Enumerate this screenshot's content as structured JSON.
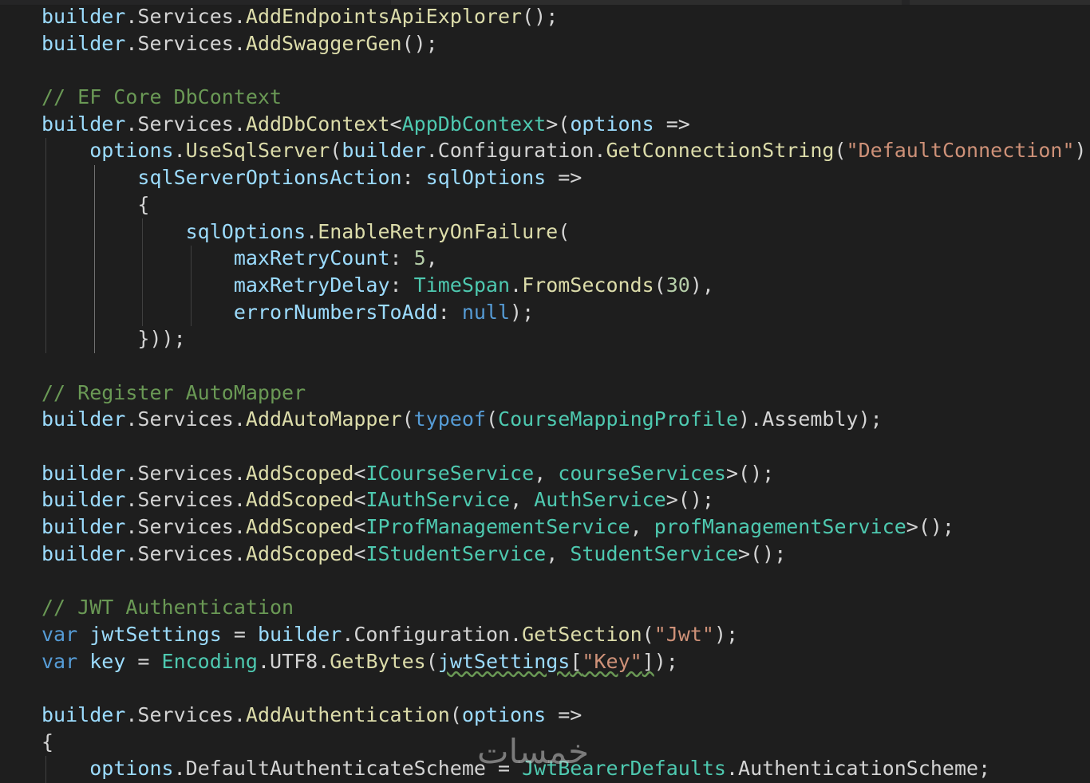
{
  "editor": {
    "language": "csharp",
    "watermark": "خمسات",
    "colors": {
      "background": "#1e1e1e",
      "variable": "#9cdcfe",
      "function": "#dcdcaa",
      "type": "#4ec9b0",
      "string": "#ce9178",
      "number": "#b5cea8",
      "keyword": "#569cd6",
      "comment": "#6a9955",
      "text": "#d4d4d4"
    },
    "lines": [
      [
        [
          "builder",
          "var"
        ],
        [
          ".",
          "punc"
        ],
        [
          "Services",
          "prop"
        ],
        [
          ".",
          "punc"
        ],
        [
          "AddEndpointsApiExplorer",
          "fn"
        ],
        [
          "();",
          "punc"
        ]
      ],
      [
        [
          "builder",
          "var"
        ],
        [
          ".",
          "punc"
        ],
        [
          "Services",
          "prop"
        ],
        [
          ".",
          "punc"
        ],
        [
          "AddSwaggerGen",
          "fn"
        ],
        [
          "();",
          "punc"
        ]
      ],
      [],
      [
        [
          "// EF Core DbContext",
          "cmt"
        ]
      ],
      [
        [
          "builder",
          "var"
        ],
        [
          ".",
          "punc"
        ],
        [
          "Services",
          "prop"
        ],
        [
          ".",
          "punc"
        ],
        [
          "AddDbContext",
          "fn"
        ],
        [
          "<",
          "punc"
        ],
        [
          "AppDbContext",
          "type"
        ],
        [
          ">(",
          "punc"
        ],
        [
          "options",
          "var"
        ],
        [
          " =>",
          "punc"
        ]
      ],
      [
        [
          "    ",
          "punc"
        ],
        [
          "options",
          "var"
        ],
        [
          ".",
          "punc"
        ],
        [
          "UseSqlServer",
          "fn"
        ],
        [
          "(",
          "punc"
        ],
        [
          "builder",
          "var"
        ],
        [
          ".",
          "punc"
        ],
        [
          "Configuration",
          "prop"
        ],
        [
          ".",
          "punc"
        ],
        [
          "GetConnectionString",
          "fn"
        ],
        [
          "(",
          "punc"
        ],
        [
          "\"DefaultConnection\"",
          "str"
        ],
        [
          ")",
          "punc"
        ]
      ],
      [
        [
          "        ",
          "punc"
        ],
        [
          "sqlServerOptionsAction",
          "var"
        ],
        [
          ": ",
          "punc"
        ],
        [
          "sqlOptions",
          "var"
        ],
        [
          " =>",
          "punc"
        ]
      ],
      [
        [
          "        {",
          "punc"
        ]
      ],
      [
        [
          "            ",
          "punc"
        ],
        [
          "sqlOptions",
          "var"
        ],
        [
          ".",
          "punc"
        ],
        [
          "EnableRetryOnFailure",
          "fn"
        ],
        [
          "(",
          "punc"
        ]
      ],
      [
        [
          "                ",
          "punc"
        ],
        [
          "maxRetryCount",
          "var"
        ],
        [
          ": ",
          "punc"
        ],
        [
          "5",
          "num"
        ],
        [
          ",",
          "punc"
        ]
      ],
      [
        [
          "                ",
          "punc"
        ],
        [
          "maxRetryDelay",
          "var"
        ],
        [
          ": ",
          "punc"
        ],
        [
          "TimeSpan",
          "type"
        ],
        [
          ".",
          "punc"
        ],
        [
          "FromSeconds",
          "fn"
        ],
        [
          "(",
          "punc"
        ],
        [
          "30",
          "num"
        ],
        [
          "),",
          "punc"
        ]
      ],
      [
        [
          "                ",
          "punc"
        ],
        [
          "errorNumbersToAdd",
          "var"
        ],
        [
          ": ",
          "punc"
        ],
        [
          "null",
          "kw"
        ],
        [
          ");",
          "punc"
        ]
      ],
      [
        [
          "        }));",
          "punc"
        ]
      ],
      [],
      [
        [
          "// Register AutoMapper",
          "cmt"
        ]
      ],
      [
        [
          "builder",
          "var"
        ],
        [
          ".",
          "punc"
        ],
        [
          "Services",
          "prop"
        ],
        [
          ".",
          "punc"
        ],
        [
          "AddAutoMapper",
          "fn"
        ],
        [
          "(",
          "punc"
        ],
        [
          "typeof",
          "kw"
        ],
        [
          "(",
          "punc"
        ],
        [
          "CourseMappingProfile",
          "type"
        ],
        [
          ").",
          "punc"
        ],
        [
          "Assembly",
          "prop"
        ],
        [
          ");",
          "punc"
        ]
      ],
      [],
      [
        [
          "builder",
          "var"
        ],
        [
          ".",
          "punc"
        ],
        [
          "Services",
          "prop"
        ],
        [
          ".",
          "punc"
        ],
        [
          "AddScoped",
          "fn"
        ],
        [
          "<",
          "punc"
        ],
        [
          "ICourseService",
          "type"
        ],
        [
          ", ",
          "punc"
        ],
        [
          "courseServices",
          "type"
        ],
        [
          ">();",
          "punc"
        ]
      ],
      [
        [
          "builder",
          "var"
        ],
        [
          ".",
          "punc"
        ],
        [
          "Services",
          "prop"
        ],
        [
          ".",
          "punc"
        ],
        [
          "AddScoped",
          "fn"
        ],
        [
          "<",
          "punc"
        ],
        [
          "IAuthService",
          "type"
        ],
        [
          ", ",
          "punc"
        ],
        [
          "AuthService",
          "type"
        ],
        [
          ">();",
          "punc"
        ]
      ],
      [
        [
          "builder",
          "var"
        ],
        [
          ".",
          "punc"
        ],
        [
          "Services",
          "prop"
        ],
        [
          ".",
          "punc"
        ],
        [
          "AddScoped",
          "fn"
        ],
        [
          "<",
          "punc"
        ],
        [
          "IProfManagementService",
          "type"
        ],
        [
          ", ",
          "punc"
        ],
        [
          "profManagementService",
          "type"
        ],
        [
          ">();",
          "punc"
        ]
      ],
      [
        [
          "builder",
          "var"
        ],
        [
          ".",
          "punc"
        ],
        [
          "Services",
          "prop"
        ],
        [
          ".",
          "punc"
        ],
        [
          "AddScoped",
          "fn"
        ],
        [
          "<",
          "punc"
        ],
        [
          "IStudentService",
          "type"
        ],
        [
          ", ",
          "punc"
        ],
        [
          "StudentService",
          "type"
        ],
        [
          ">();",
          "punc"
        ]
      ],
      [],
      [
        [
          "// JWT Authentication",
          "cmt"
        ]
      ],
      [
        [
          "var",
          "kw"
        ],
        [
          " ",
          "punc"
        ],
        [
          "jwtSettings",
          "var"
        ],
        [
          " = ",
          "punc"
        ],
        [
          "builder",
          "var"
        ],
        [
          ".",
          "punc"
        ],
        [
          "Configuration",
          "prop"
        ],
        [
          ".",
          "punc"
        ],
        [
          "GetSection",
          "fn"
        ],
        [
          "(",
          "punc"
        ],
        [
          "\"Jwt\"",
          "str"
        ],
        [
          ");",
          "punc"
        ]
      ],
      [
        [
          "var",
          "kw"
        ],
        [
          " ",
          "punc"
        ],
        [
          "key",
          "var"
        ],
        [
          " = ",
          "punc"
        ],
        [
          "Encoding",
          "type"
        ],
        [
          ".",
          "punc"
        ],
        [
          "UTF8",
          "prop"
        ],
        [
          ".",
          "punc"
        ],
        [
          "GetBytes",
          "fn"
        ],
        [
          "(",
          "punc"
        ],
        [
          "jwtSettings[\"Key\"]",
          "squig"
        ],
        [
          ");",
          "punc"
        ]
      ],
      [],
      [
        [
          "builder",
          "var"
        ],
        [
          ".",
          "punc"
        ],
        [
          "Services",
          "prop"
        ],
        [
          ".",
          "punc"
        ],
        [
          "AddAuthentication",
          "fn"
        ],
        [
          "(",
          "punc"
        ],
        [
          "options",
          "var"
        ],
        [
          " =>",
          "punc"
        ]
      ],
      [
        [
          "{",
          "punc"
        ]
      ],
      [
        [
          "    ",
          "punc"
        ],
        [
          "options",
          "var"
        ],
        [
          ".",
          "punc"
        ],
        [
          "DefaultAuthenticateScheme",
          "prop"
        ],
        [
          " = ",
          "punc"
        ],
        [
          "JwtBearerDefaults",
          "type"
        ],
        [
          ".",
          "punc"
        ],
        [
          "AuthenticationScheme",
          "prop"
        ],
        [
          ";",
          "punc"
        ]
      ]
    ]
  }
}
